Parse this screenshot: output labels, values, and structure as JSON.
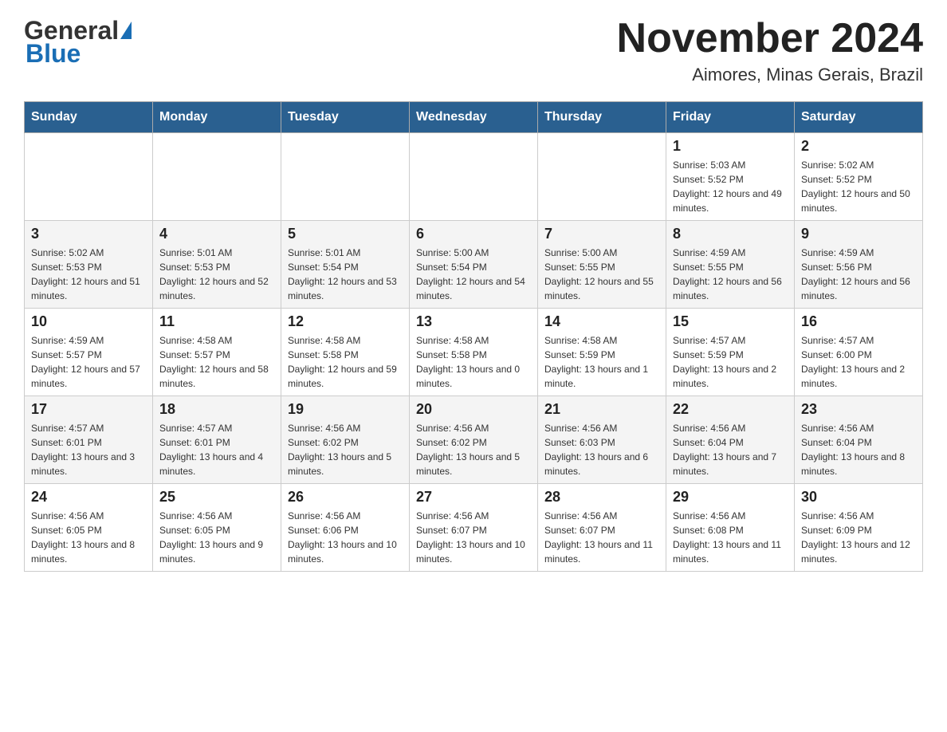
{
  "header": {
    "logo_general": "General",
    "logo_blue": "Blue",
    "month_title": "November 2024",
    "location": "Aimores, Minas Gerais, Brazil"
  },
  "days_of_week": [
    "Sunday",
    "Monday",
    "Tuesday",
    "Wednesday",
    "Thursday",
    "Friday",
    "Saturday"
  ],
  "weeks": [
    {
      "days": [
        {
          "num": "",
          "info": ""
        },
        {
          "num": "",
          "info": ""
        },
        {
          "num": "",
          "info": ""
        },
        {
          "num": "",
          "info": ""
        },
        {
          "num": "",
          "info": ""
        },
        {
          "num": "1",
          "info": "Sunrise: 5:03 AM\nSunset: 5:52 PM\nDaylight: 12 hours and 49 minutes."
        },
        {
          "num": "2",
          "info": "Sunrise: 5:02 AM\nSunset: 5:52 PM\nDaylight: 12 hours and 50 minutes."
        }
      ]
    },
    {
      "days": [
        {
          "num": "3",
          "info": "Sunrise: 5:02 AM\nSunset: 5:53 PM\nDaylight: 12 hours and 51 minutes."
        },
        {
          "num": "4",
          "info": "Sunrise: 5:01 AM\nSunset: 5:53 PM\nDaylight: 12 hours and 52 minutes."
        },
        {
          "num": "5",
          "info": "Sunrise: 5:01 AM\nSunset: 5:54 PM\nDaylight: 12 hours and 53 minutes."
        },
        {
          "num": "6",
          "info": "Sunrise: 5:00 AM\nSunset: 5:54 PM\nDaylight: 12 hours and 54 minutes."
        },
        {
          "num": "7",
          "info": "Sunrise: 5:00 AM\nSunset: 5:55 PM\nDaylight: 12 hours and 55 minutes."
        },
        {
          "num": "8",
          "info": "Sunrise: 4:59 AM\nSunset: 5:55 PM\nDaylight: 12 hours and 56 minutes."
        },
        {
          "num": "9",
          "info": "Sunrise: 4:59 AM\nSunset: 5:56 PM\nDaylight: 12 hours and 56 minutes."
        }
      ]
    },
    {
      "days": [
        {
          "num": "10",
          "info": "Sunrise: 4:59 AM\nSunset: 5:57 PM\nDaylight: 12 hours and 57 minutes."
        },
        {
          "num": "11",
          "info": "Sunrise: 4:58 AM\nSunset: 5:57 PM\nDaylight: 12 hours and 58 minutes."
        },
        {
          "num": "12",
          "info": "Sunrise: 4:58 AM\nSunset: 5:58 PM\nDaylight: 12 hours and 59 minutes."
        },
        {
          "num": "13",
          "info": "Sunrise: 4:58 AM\nSunset: 5:58 PM\nDaylight: 13 hours and 0 minutes."
        },
        {
          "num": "14",
          "info": "Sunrise: 4:58 AM\nSunset: 5:59 PM\nDaylight: 13 hours and 1 minute."
        },
        {
          "num": "15",
          "info": "Sunrise: 4:57 AM\nSunset: 5:59 PM\nDaylight: 13 hours and 2 minutes."
        },
        {
          "num": "16",
          "info": "Sunrise: 4:57 AM\nSunset: 6:00 PM\nDaylight: 13 hours and 2 minutes."
        }
      ]
    },
    {
      "days": [
        {
          "num": "17",
          "info": "Sunrise: 4:57 AM\nSunset: 6:01 PM\nDaylight: 13 hours and 3 minutes."
        },
        {
          "num": "18",
          "info": "Sunrise: 4:57 AM\nSunset: 6:01 PM\nDaylight: 13 hours and 4 minutes."
        },
        {
          "num": "19",
          "info": "Sunrise: 4:56 AM\nSunset: 6:02 PM\nDaylight: 13 hours and 5 minutes."
        },
        {
          "num": "20",
          "info": "Sunrise: 4:56 AM\nSunset: 6:02 PM\nDaylight: 13 hours and 5 minutes."
        },
        {
          "num": "21",
          "info": "Sunrise: 4:56 AM\nSunset: 6:03 PM\nDaylight: 13 hours and 6 minutes."
        },
        {
          "num": "22",
          "info": "Sunrise: 4:56 AM\nSunset: 6:04 PM\nDaylight: 13 hours and 7 minutes."
        },
        {
          "num": "23",
          "info": "Sunrise: 4:56 AM\nSunset: 6:04 PM\nDaylight: 13 hours and 8 minutes."
        }
      ]
    },
    {
      "days": [
        {
          "num": "24",
          "info": "Sunrise: 4:56 AM\nSunset: 6:05 PM\nDaylight: 13 hours and 8 minutes."
        },
        {
          "num": "25",
          "info": "Sunrise: 4:56 AM\nSunset: 6:05 PM\nDaylight: 13 hours and 9 minutes."
        },
        {
          "num": "26",
          "info": "Sunrise: 4:56 AM\nSunset: 6:06 PM\nDaylight: 13 hours and 10 minutes."
        },
        {
          "num": "27",
          "info": "Sunrise: 4:56 AM\nSunset: 6:07 PM\nDaylight: 13 hours and 10 minutes."
        },
        {
          "num": "28",
          "info": "Sunrise: 4:56 AM\nSunset: 6:07 PM\nDaylight: 13 hours and 11 minutes."
        },
        {
          "num": "29",
          "info": "Sunrise: 4:56 AM\nSunset: 6:08 PM\nDaylight: 13 hours and 11 minutes."
        },
        {
          "num": "30",
          "info": "Sunrise: 4:56 AM\nSunset: 6:09 PM\nDaylight: 13 hours and 12 minutes."
        }
      ]
    }
  ]
}
